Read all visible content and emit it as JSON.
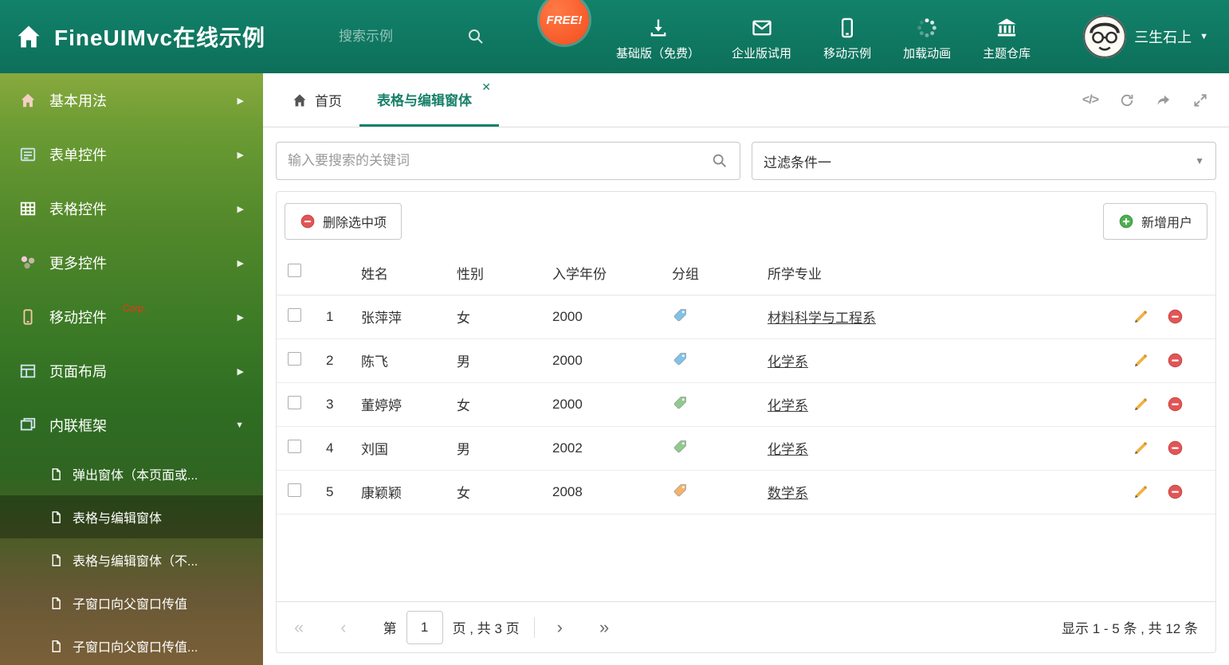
{
  "colors": {
    "accent": "#17806a",
    "danger": "#e25555",
    "success": "#4caf50",
    "tag_blue": "#7fc3e8",
    "tag_green": "#8fca8f",
    "tag_orange": "#f5b26b"
  },
  "header": {
    "title": "FineUIMvc在线示例",
    "search_placeholder": "搜索示例",
    "free_badge": "FREE!",
    "nav_items": [
      {
        "label": "基础版（免费）"
      },
      {
        "label": "企业版试用"
      },
      {
        "label": "移动示例"
      },
      {
        "label": "加载动画"
      },
      {
        "label": "主题仓库"
      }
    ],
    "user_name": "三生石上"
  },
  "sidebar": {
    "items": [
      {
        "label": "基本用法"
      },
      {
        "label": "表单控件"
      },
      {
        "label": "表格控件"
      },
      {
        "label": "更多控件"
      },
      {
        "label": "移动控件",
        "badge": "Corp."
      },
      {
        "label": "页面布局"
      },
      {
        "label": "内联框架"
      }
    ],
    "subitems": [
      {
        "label": "弹出窗体（本页面或..."
      },
      {
        "label": "表格与编辑窗体"
      },
      {
        "label": "表格与编辑窗体（不..."
      },
      {
        "label": "子窗口向父窗口传值"
      },
      {
        "label": "子窗口向父窗口传值..."
      }
    ]
  },
  "tabs": {
    "home": "首页",
    "active": "表格与编辑窗体"
  },
  "toolbar": {
    "search_placeholder": "输入要搜索的关键词",
    "filter_value": "过滤条件一",
    "delete_label": "删除选中项",
    "add_label": "新增用户"
  },
  "table": {
    "headers": {
      "name": "姓名",
      "gender": "性别",
      "year": "入学年份",
      "group": "分组",
      "major": "所学专业"
    },
    "rows": [
      {
        "num": "1",
        "name": "张萍萍",
        "gender": "女",
        "year": "2000",
        "tag_color": "#7fc3e8",
        "major": "材料科学与工程系"
      },
      {
        "num": "2",
        "name": "陈飞",
        "gender": "男",
        "year": "2000",
        "tag_color": "#7fc3e8",
        "major": "化学系"
      },
      {
        "num": "3",
        "name": "董婷婷",
        "gender": "女",
        "year": "2000",
        "tag_color": "#8fca8f",
        "major": "化学系"
      },
      {
        "num": "4",
        "name": "刘国",
        "gender": "男",
        "year": "2002",
        "tag_color": "#8fca8f",
        "major": "化学系"
      },
      {
        "num": "5",
        "name": "康颖颖",
        "gender": "女",
        "year": "2008",
        "tag_color": "#f5b26b",
        "major": "数学系"
      }
    ]
  },
  "pagination": {
    "page_label_before": "第",
    "current_page": "1",
    "page_label_after": "页 , 共 3 页",
    "summary": "显示 1 - 5 条 , 共 12 条"
  }
}
